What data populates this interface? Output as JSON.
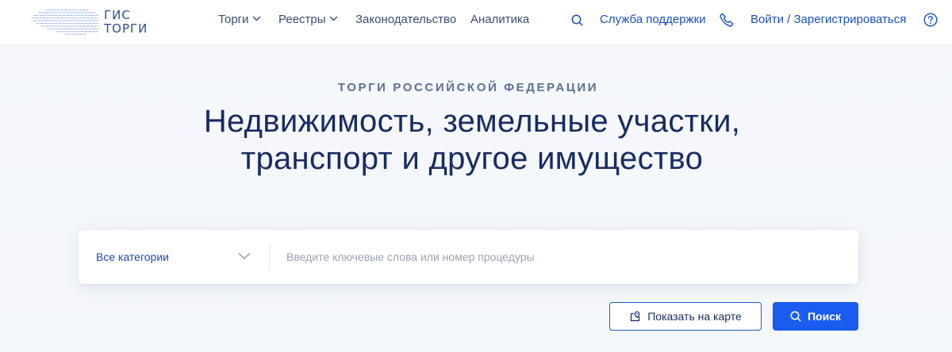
{
  "header": {
    "logo": {
      "line1": "ГИС",
      "line2": "ТОРГИ"
    },
    "nav": [
      {
        "label": "Торги",
        "has_dropdown": true
      },
      {
        "label": "Реестры",
        "has_dropdown": true
      },
      {
        "label": "Законодательство",
        "has_dropdown": false
      },
      {
        "label": "Аналитика",
        "has_dropdown": false
      }
    ],
    "support_label": "Служба поддержки",
    "login_label": "Войти / Зарегистрироваться",
    "icons": [
      "search-icon",
      "phone-icon",
      "help-icon"
    ]
  },
  "hero": {
    "eyebrow": "ТОРГИ РОССИЙСКОЙ ФЕДЕРАЦИИ",
    "headline_line1": "Недвижимость, земельные участки,",
    "headline_line2": "транспорт и другое имущество"
  },
  "search": {
    "category_selected": "Все категории",
    "placeholder": "Введите ключевые слова или номер процедуры",
    "map_button_label": "Показать на карте",
    "search_button_label": "Поиск"
  },
  "colors": {
    "accent": "#1a5cf0",
    "link": "#1b4fc4",
    "headline": "#172b63",
    "eyebrow": "#5c6f93"
  }
}
